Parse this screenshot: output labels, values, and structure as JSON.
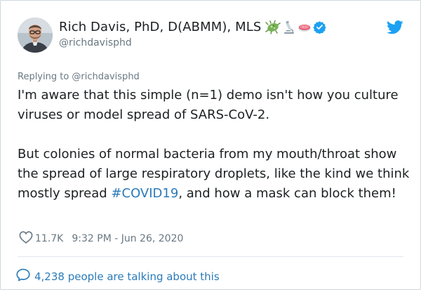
{
  "author": {
    "display_name": "Rich Davis, PhD, D(ABMM), MLS",
    "handle": "@richdavisphd",
    "name_icons": [
      "microbe-icon",
      "microscope-icon",
      "petri-dish-icon",
      "verified-badge-icon"
    ]
  },
  "reply_context": "Replying to @richdavisphd",
  "tweet": {
    "paragraph1": "I'm aware that this simple (n=1) demo isn't how you culture viruses or model spread of SARS-CoV-2.",
    "paragraph2_before": "But colonies of normal bacteria from my mouth/throat show the spread of large respiratory droplets, like the kind we think mostly spread ",
    "hashtag": "#COVID19",
    "paragraph2_after": ", and how a mask can block them!"
  },
  "meta": {
    "likes": "11.7K",
    "timestamp": "9:32 PM - Jun 26, 2020"
  },
  "conversation": {
    "label": "4,238 people are talking about this"
  },
  "colors": {
    "link": "#2b7bb9",
    "text": "#1c2022",
    "muted": "#697882",
    "twitter_blue": "#1da1f2"
  }
}
